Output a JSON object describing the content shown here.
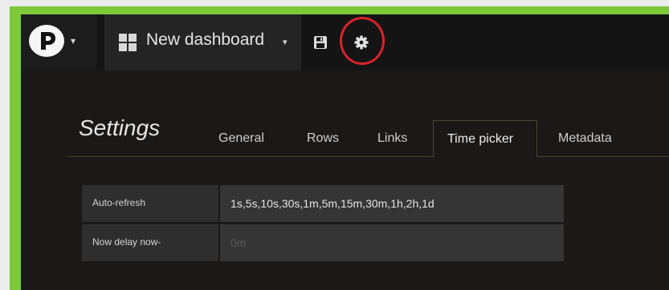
{
  "colors": {
    "frame_border": "#7dc93a",
    "app_background": "#1b1917",
    "highlight_ring": "#d8232a"
  },
  "topbar": {
    "logo_icon": "p-logo-icon",
    "dashboard_title": "New dashboard",
    "dashboard_icon": "grid-icon",
    "save_icon": "save-icon",
    "settings_icon": "gear-icon"
  },
  "settings": {
    "title": "Settings",
    "tabs": [
      {
        "label": "General"
      },
      {
        "label": "Rows"
      },
      {
        "label": "Links"
      },
      {
        "label": "Time picker",
        "active": true
      },
      {
        "label": "Metadata"
      }
    ]
  },
  "time_picker": {
    "auto_refresh": {
      "label": "Auto-refresh",
      "value": "1s,5s,10s,30s,1m,5m,15m,30m,1h,2h,1d"
    },
    "now_delay": {
      "label": "Now delay now-",
      "placeholder": "0m"
    }
  }
}
